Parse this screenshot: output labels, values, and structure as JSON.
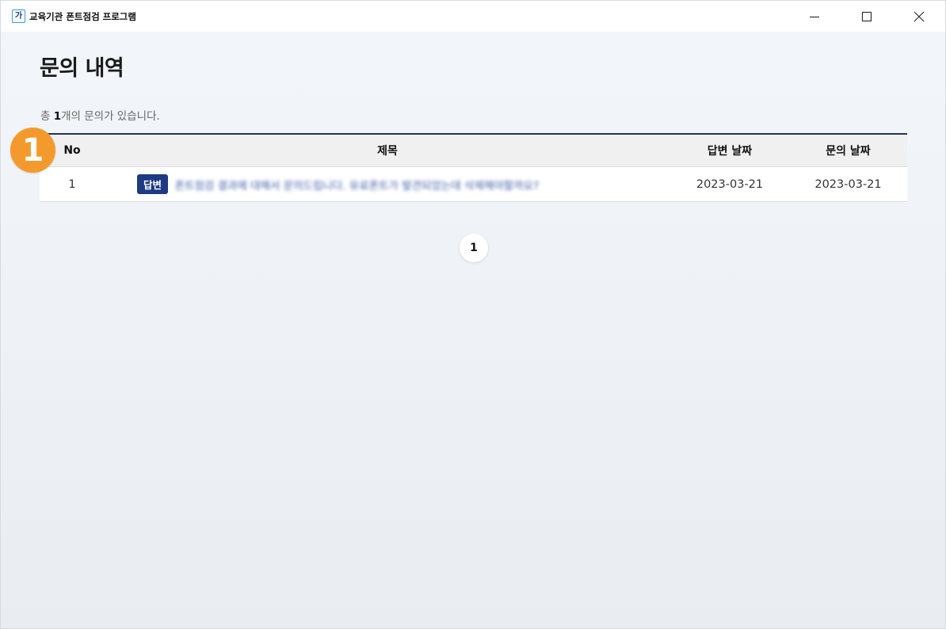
{
  "window": {
    "logo_text": "가",
    "title": "교육기관 폰트점검 프로그램"
  },
  "page": {
    "title": "문의 내역",
    "summary_prefix": "총 ",
    "summary_count": "1",
    "summary_suffix": "개의 문의가 있습니다."
  },
  "step_marker": "1",
  "table": {
    "headers": {
      "no": "No",
      "title": "제목",
      "answer_date": "답변 날짜",
      "inquiry_date": "문의 날짜"
    },
    "rows": [
      {
        "no": "1",
        "badge": "답변",
        "title": "폰트점검 결과에 대해서 문의드립니다. 유료폰트가 발견되었는데 삭제해야할까요?",
        "answer_date": "2023-03-21",
        "inquiry_date": "2023-03-21"
      }
    ]
  },
  "pagination": {
    "current": "1"
  },
  "colors": {
    "accent_navy": "#1d3562",
    "badge_blue": "#1d3a82",
    "marker_orange": "#f49a2d"
  }
}
